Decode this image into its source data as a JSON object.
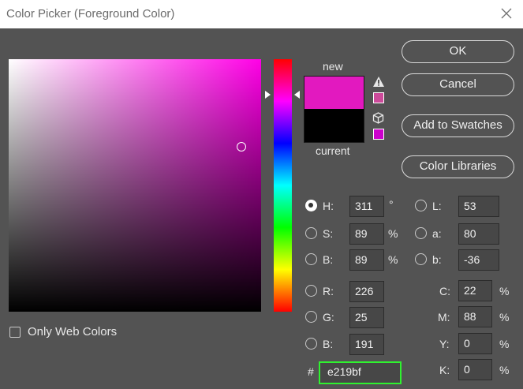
{
  "window": {
    "title": "Color Picker (Foreground Color)",
    "close_icon": "close-icon"
  },
  "colors": {
    "new": "#e219bf",
    "current": "#000000",
    "hue_pure": "#ff00e6",
    "hex_highlight": "#2ff22f"
  },
  "preview": {
    "new_label": "new",
    "current_label": "current"
  },
  "buttons": {
    "ok": "OK",
    "cancel": "Cancel",
    "add_to_swatches": "Add to Swatches",
    "color_libraries": "Color Libraries"
  },
  "hsb": [
    {
      "label": "H:",
      "value": "311",
      "unit": "°",
      "selected": true
    },
    {
      "label": "S:",
      "value": "89",
      "unit": "%",
      "selected": false
    },
    {
      "label": "B:",
      "value": "89",
      "unit": "%",
      "selected": false
    }
  ],
  "lab": [
    {
      "label": "L:",
      "value": "53"
    },
    {
      "label": "a:",
      "value": "80"
    },
    {
      "label": "b:",
      "value": "-36"
    }
  ],
  "rgb": [
    {
      "label": "R:",
      "value": "226"
    },
    {
      "label": "G:",
      "value": "25"
    },
    {
      "label": "B:",
      "value": "191"
    }
  ],
  "cmyk": [
    {
      "label": "C:",
      "value": "22",
      "unit": "%"
    },
    {
      "label": "M:",
      "value": "88",
      "unit": "%"
    },
    {
      "label": "Y:",
      "value": "0",
      "unit": "%"
    },
    {
      "label": "K:",
      "value": "0",
      "unit": "%"
    }
  ],
  "hex": {
    "label": "#",
    "value": "e219bf"
  },
  "only_web_colors": {
    "label": "Only Web Colors",
    "checked": false
  },
  "icons": {
    "warning": "warning-icon",
    "cube": "cube-icon"
  }
}
